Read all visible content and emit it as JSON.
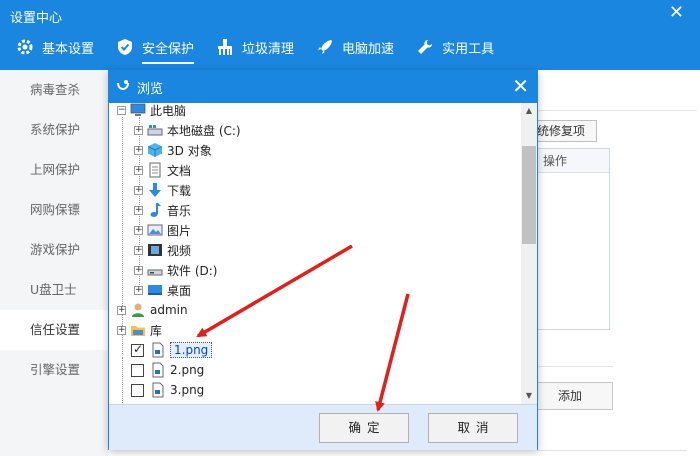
{
  "app": {
    "title": "设置中心",
    "close": "✕"
  },
  "tabs": [
    {
      "label": "基本设置",
      "icon": "gear-icon"
    },
    {
      "label": "安全保护",
      "icon": "shield-icon"
    },
    {
      "label": "垃圾清理",
      "icon": "broom-icon"
    },
    {
      "label": "电脑加速",
      "icon": "rocket-icon"
    },
    {
      "label": "实用工具",
      "icon": "wrench-icon"
    }
  ],
  "sidebar": {
    "items": [
      {
        "label": "病毒查杀"
      },
      {
        "label": "系统保护"
      },
      {
        "label": "上网保护"
      },
      {
        "label": "网购保镖"
      },
      {
        "label": "游戏保护"
      },
      {
        "label": "U盘卫士"
      },
      {
        "label": "信任设置"
      },
      {
        "label": "引擎设置"
      }
    ]
  },
  "background": {
    "repair_button": "统修复项",
    "table_header": "操作",
    "add_button": "添加"
  },
  "dialog": {
    "title": "浏览",
    "close": "✕",
    "tree": {
      "this_pc": "此电脑",
      "local_disk": "本地磁盘 (C:)",
      "objects_3d": "3D 对象",
      "documents": "文档",
      "downloads": "下载",
      "music": "音乐",
      "pictures": "图片",
      "videos": "视频",
      "software_disk": "软件 (D:)",
      "desktop": "桌面",
      "admin": "admin",
      "library": "库",
      "file1": "1.png",
      "file2": "2.png",
      "file3": "3.png"
    },
    "ok": "确定",
    "cancel": "取消"
  },
  "colors": {
    "accent": "#1a86e0",
    "arrow": "#e0201c"
  }
}
